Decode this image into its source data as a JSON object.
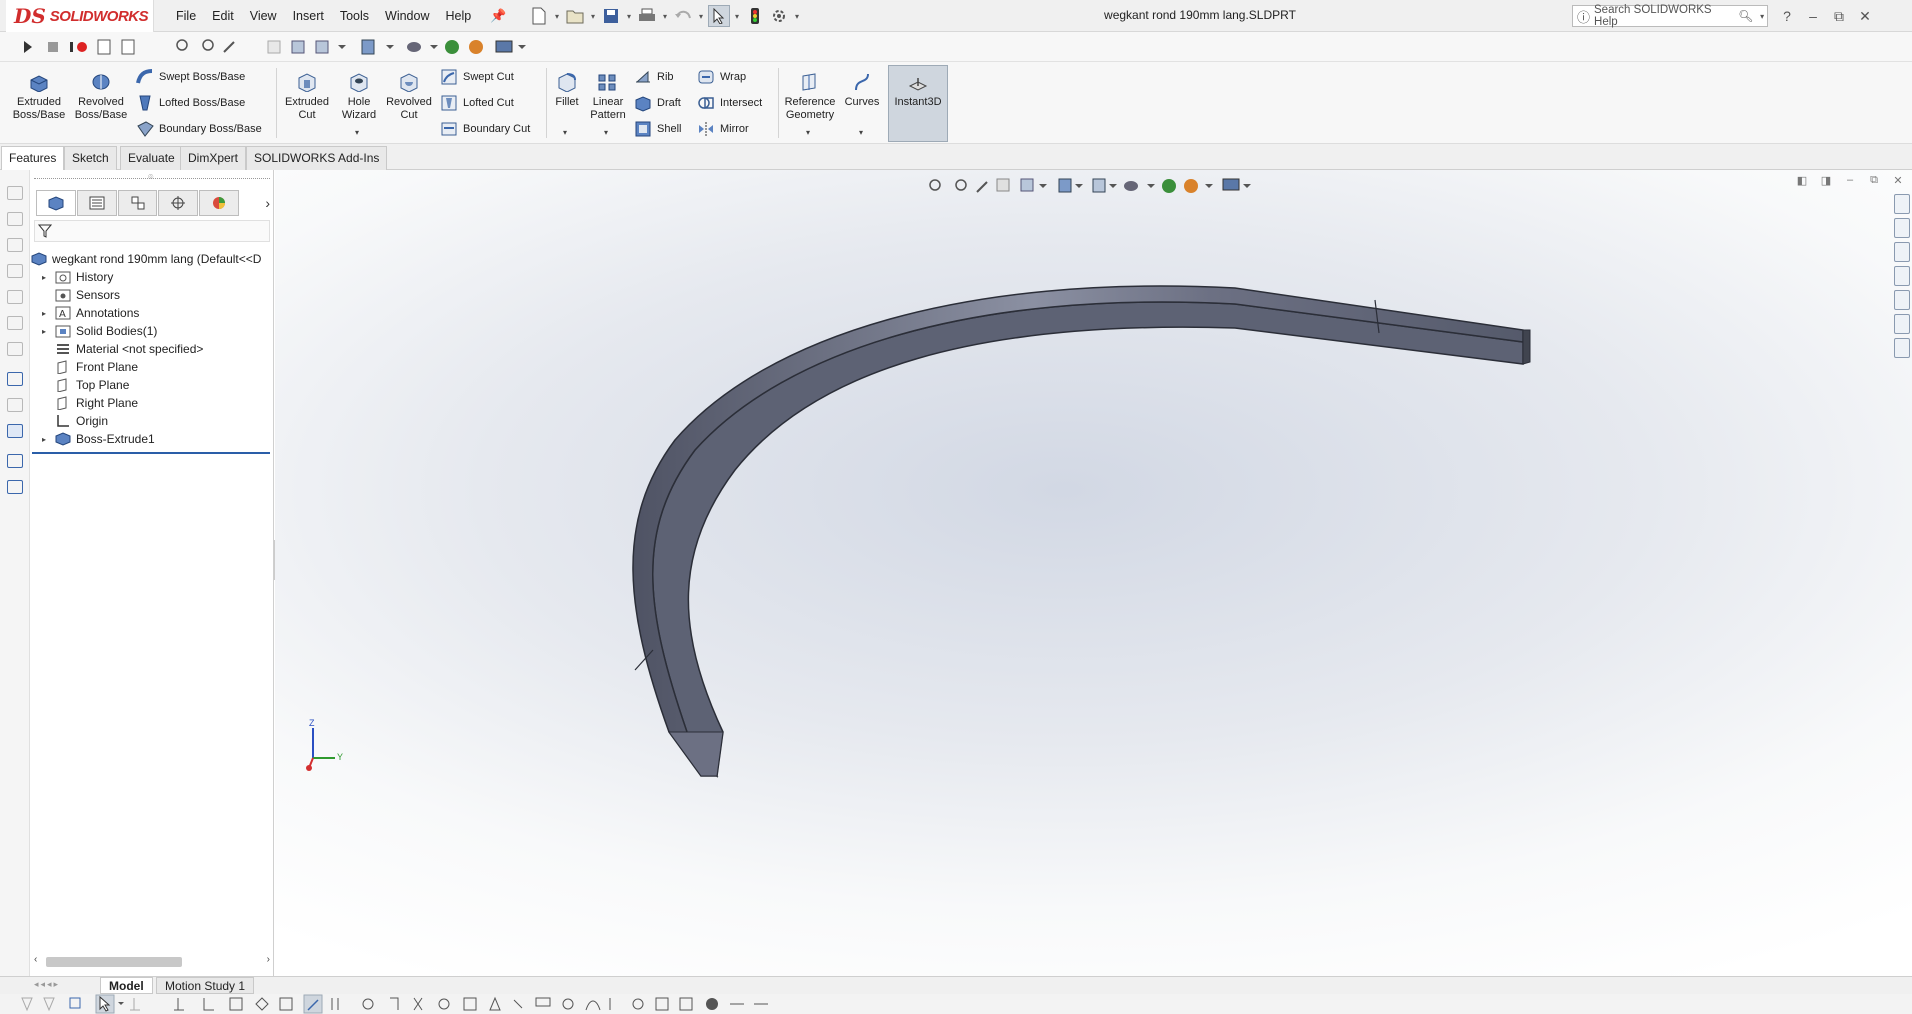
{
  "app": {
    "brand_ds": "DS",
    "brand_name": "SOLIDWORKS",
    "document_title": "wegkant rond 190mm lang.SLDPRT"
  },
  "menu": [
    "File",
    "Edit",
    "View",
    "Insert",
    "Tools",
    "Window",
    "Help"
  ],
  "search": {
    "placeholder": "Search SOLIDWORKS Help"
  },
  "window_controls": {
    "help": "?",
    "minimize": "–",
    "restore": "⧉",
    "close": "✕"
  },
  "ribbon": {
    "extruded_boss": "Extruded Boss/Base",
    "revolved_boss": "Revolved Boss/Base",
    "swept_boss": "Swept Boss/Base",
    "lofted_boss": "Lofted Boss/Base",
    "boundary_boss": "Boundary Boss/Base",
    "extruded_cut": "Extruded Cut",
    "hole_wizard": "Hole Wizard",
    "revolved_cut": "Revolved Cut",
    "swept_cut": "Swept Cut",
    "lofted_cut": "Lofted Cut",
    "boundary_cut": "Boundary Cut",
    "fillet": "Fillet",
    "linear_pattern": "Linear Pattern",
    "rib": "Rib",
    "draft": "Draft",
    "shell": "Shell",
    "wrap": "Wrap",
    "intersect": "Intersect",
    "mirror": "Mirror",
    "reference_geometry": "Reference Geometry",
    "curves": "Curves",
    "instant3d": "Instant3D"
  },
  "command_tabs": [
    "Features",
    "Sketch",
    "Evaluate",
    "DimXpert",
    "SOLIDWORKS Add-Ins"
  ],
  "feature_tree": {
    "root": "wegkant rond 190mm lang  (Default<<D",
    "items": [
      {
        "label": "History",
        "icon": "history-folder-icon"
      },
      {
        "label": "Sensors",
        "icon": "sensors-icon"
      },
      {
        "label": "Annotations",
        "icon": "annotations-icon"
      },
      {
        "label": "Solid Bodies(1)",
        "icon": "solid-bodies-icon"
      },
      {
        "label": "Material <not specified>",
        "icon": "material-icon"
      },
      {
        "label": "Front Plane",
        "icon": "plane-icon"
      },
      {
        "label": "Top Plane",
        "icon": "plane-icon"
      },
      {
        "label": "Right Plane",
        "icon": "plane-icon"
      },
      {
        "label": "Origin",
        "icon": "origin-icon"
      },
      {
        "label": "Boss-Extrude1",
        "icon": "boss-extrude-icon"
      }
    ]
  },
  "triad": {
    "z": "Z",
    "y": "Y"
  },
  "bottom_tabs": [
    "Model",
    "Motion Study 1"
  ],
  "colors": {
    "model_face": "#5d6274",
    "model_edge": "#2b2e38",
    "brand_red": "#d12d2d",
    "selection_line": "#2a5ea8"
  }
}
